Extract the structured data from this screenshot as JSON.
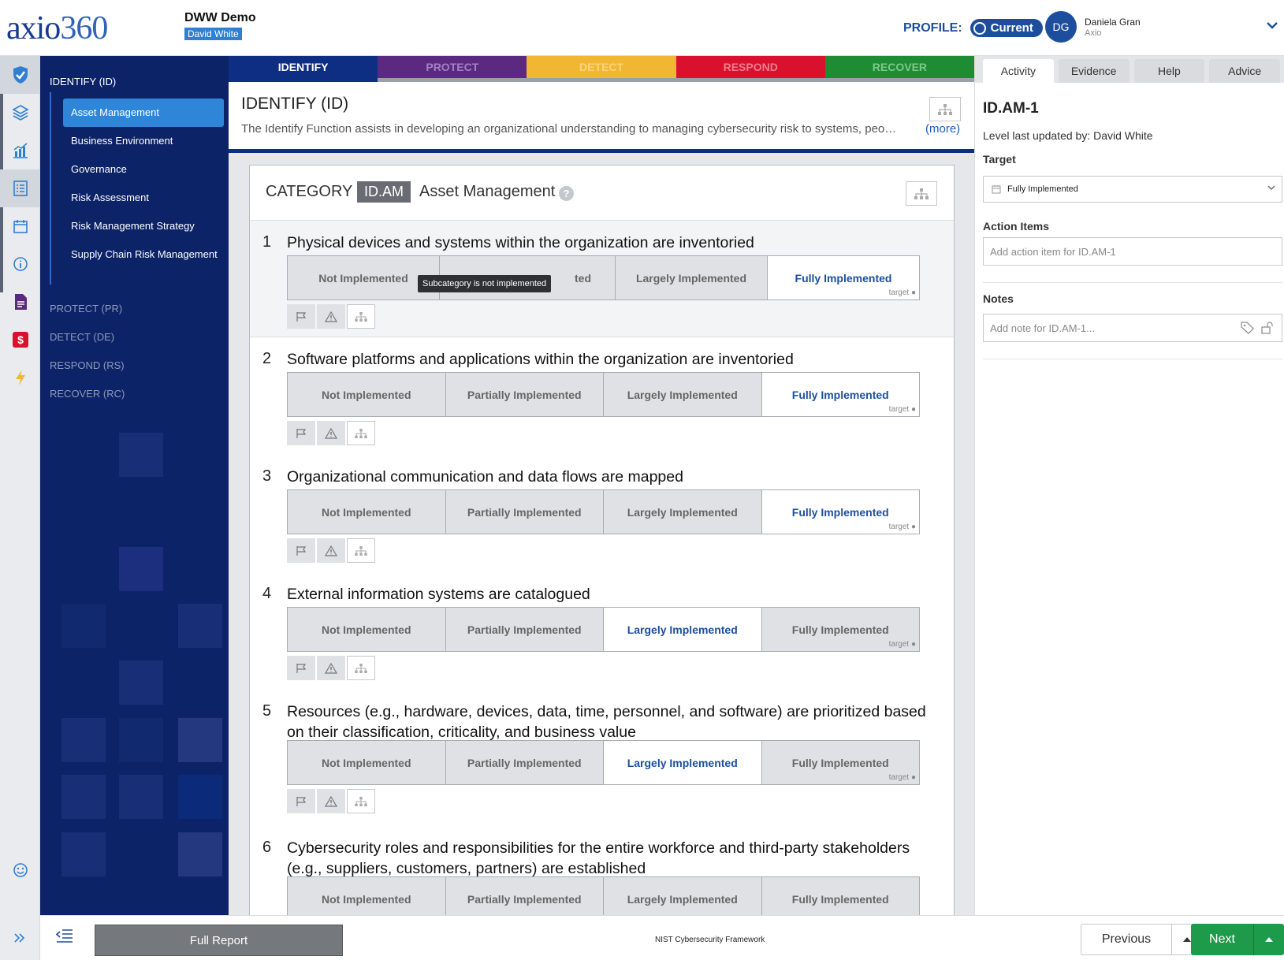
{
  "header": {
    "logo_main": "axio",
    "logo_num": "360",
    "project_name": "DWW Demo",
    "project_user": "David White",
    "profile_label": "PROFILE:",
    "profile_value": "Current",
    "avatar_initials": "DG",
    "user_name": "Daniela Gran",
    "user_org": "Axio",
    "brand_color": "#1d4e9e"
  },
  "rail": {
    "icons": [
      "shield-check-icon",
      "layers-icon",
      "chart-icon",
      "checklist-icon",
      "calendar-icon",
      "info-icon",
      "document-icon",
      "dollar-icon",
      "lightning-icon",
      "smiley-icon",
      "double-chevron-icon"
    ]
  },
  "leftnav": {
    "function": "IDENTIFY (ID)",
    "categories": [
      {
        "label": "Asset Management",
        "active": true
      },
      {
        "label": "Business Environment"
      },
      {
        "label": "Governance"
      },
      {
        "label": "Risk Assessment"
      },
      {
        "label": "Risk Management Strategy"
      },
      {
        "label": "Supply Chain Risk Management"
      }
    ],
    "other_functions": [
      "PROTECT (PR)",
      "DETECT (DE)",
      "RESPOND (RS)",
      "RECOVER (RC)"
    ]
  },
  "function_tabs": [
    {
      "label": "IDENTIFY",
      "bg": "#0d2e82",
      "color": "#ffffff",
      "active": true
    },
    {
      "label": "PROTECT",
      "bg": "#5b2a80",
      "color": "#a580c4"
    },
    {
      "label": "DETECT",
      "bg": "#f2b732",
      "color": "#f7d47d"
    },
    {
      "label": "RESPOND",
      "bg": "#d9102e",
      "color": "#f27b8c"
    },
    {
      "label": "RECOVER",
      "bg": "#1d8c33",
      "color": "#7cc98a"
    }
  ],
  "main": {
    "title": "IDENTIFY (ID)",
    "description": "The Identify Function assists in developing an organizational understanding to managing cybersecurity risk to systems, peo…",
    "more": "(more)",
    "category_label": "CATEGORY",
    "category_id": "ID.AM",
    "category_name": "Asset Management",
    "category_help": "?",
    "tooltip": "Subcategory is not implemented",
    "target_label": "target ●",
    "level_labels": [
      "Not Implemented",
      "Partially Implemented",
      "Largely Implemented",
      "Fully Implemented"
    ],
    "level_partial_obscured": "ted",
    "subcategories": [
      {
        "num": "1",
        "text": "Physical devices and systems within the organization are inventoried",
        "selected": 3,
        "target": 3
      },
      {
        "num": "2",
        "text": "Software platforms and applications within the organization are inventoried",
        "selected": 3,
        "target": 3
      },
      {
        "num": "3",
        "text": "Organizational communication and data flows are mapped",
        "selected": 3,
        "target": 3
      },
      {
        "num": "4",
        "text": "External information systems are catalogued",
        "selected": 2,
        "target": 3
      },
      {
        "num": "5",
        "text": "Resources (e.g., hardware, devices, data, time, personnel, and software) are prioritized based on their classification, criticality, and business value",
        "selected": 2,
        "target": 3
      },
      {
        "num": "6",
        "text": "Cybersecurity roles and responsibilities for the entire workforce and third-party stakeholders (e.g., suppliers, customers, partners) are established"
      }
    ]
  },
  "right_panel": {
    "tabs": [
      "Activity",
      "Evidence",
      "Help",
      "Advice"
    ],
    "active_tab": "Activity",
    "title": "ID.AM-1",
    "updated": "Level last updated by: David White",
    "target_label": "Target",
    "target_value": "Fully Implemented",
    "action_items_label": "Action Items",
    "action_placeholder": "Add action item for ID.AM-1",
    "notes_label": "Notes",
    "notes_placeholder": "Add note for ID.AM-1..."
  },
  "bottom": {
    "full_report": "Full Report",
    "framework": "NIST Cybersecurity Framework",
    "previous": "Previous",
    "next": "Next",
    "next_color": "#1e9a4b"
  }
}
